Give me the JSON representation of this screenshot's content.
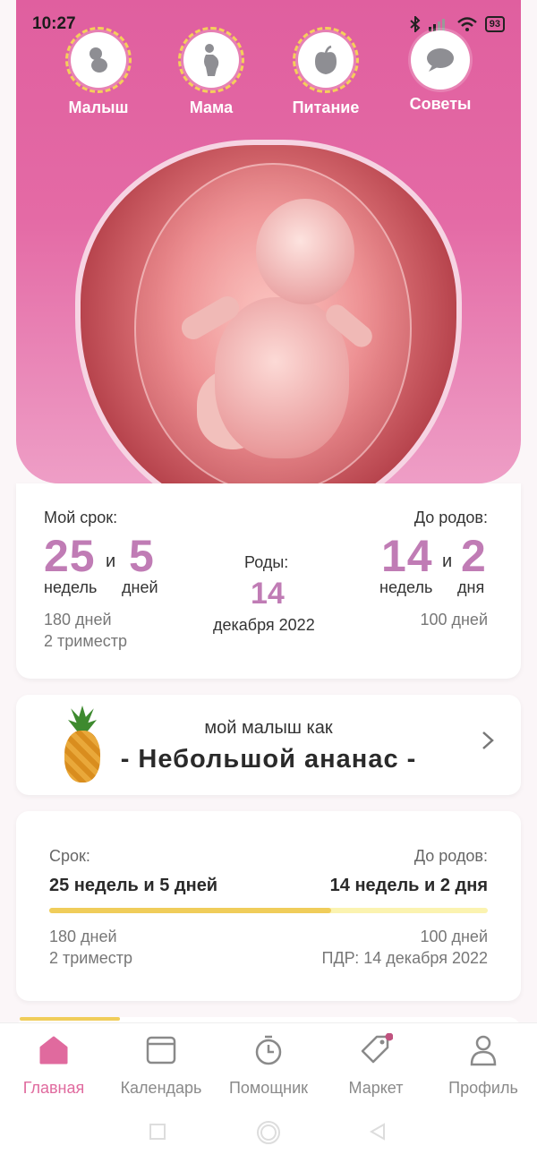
{
  "status": {
    "time": "10:27",
    "battery": "93"
  },
  "topnav": [
    {
      "label": "Малыш",
      "icon": "baby-icon"
    },
    {
      "label": "Мама",
      "icon": "pregnant-woman-icon"
    },
    {
      "label": "Питание",
      "icon": "apple-icon"
    },
    {
      "label": "Советы",
      "icon": "chat-bubble-icon"
    }
  ],
  "term": {
    "title": "Мой срок:",
    "weeks": "25",
    "and": "и",
    "days": "5",
    "weeks_label": "недель",
    "days_label": "дней",
    "total_days": "180 дней",
    "trimester": "2 триместр"
  },
  "birth": {
    "title": "Роды:",
    "day": "14",
    "month_year": "декабря 2022"
  },
  "remaining": {
    "title": "До родов:",
    "weeks": "14",
    "and": "и",
    "days": "2",
    "weeks_label": "недель",
    "days_label": "дня",
    "total_days": "100 дней"
  },
  "fruit": {
    "caption": "мой малыш как",
    "name": "- Небольшой ананас -"
  },
  "progress": {
    "left_title": "Срок:",
    "left_value": "25 недель и 5 дней",
    "right_title": "До родов:",
    "right_value": "14 недель и 2 дня",
    "fraction": 0.642,
    "left_days": "180 дней",
    "left_trimester": "2 триместр",
    "right_days": "100 дней",
    "due_date": "ПДР: 14 декабря 2022"
  },
  "bottomnav": [
    {
      "label": "Главная",
      "icon": "home-icon",
      "active": true
    },
    {
      "label": "Календарь",
      "icon": "calendar-icon"
    },
    {
      "label": "Помощник",
      "icon": "stopwatch-icon"
    },
    {
      "label": "Маркет",
      "icon": "tag-icon"
    },
    {
      "label": "Профиль",
      "icon": "profile-icon"
    }
  ],
  "colors": {
    "accent": "#e06a9e",
    "number": "#c07cb5",
    "progress": "#f0cd5a",
    "progress_track": "#fbf3b0"
  }
}
